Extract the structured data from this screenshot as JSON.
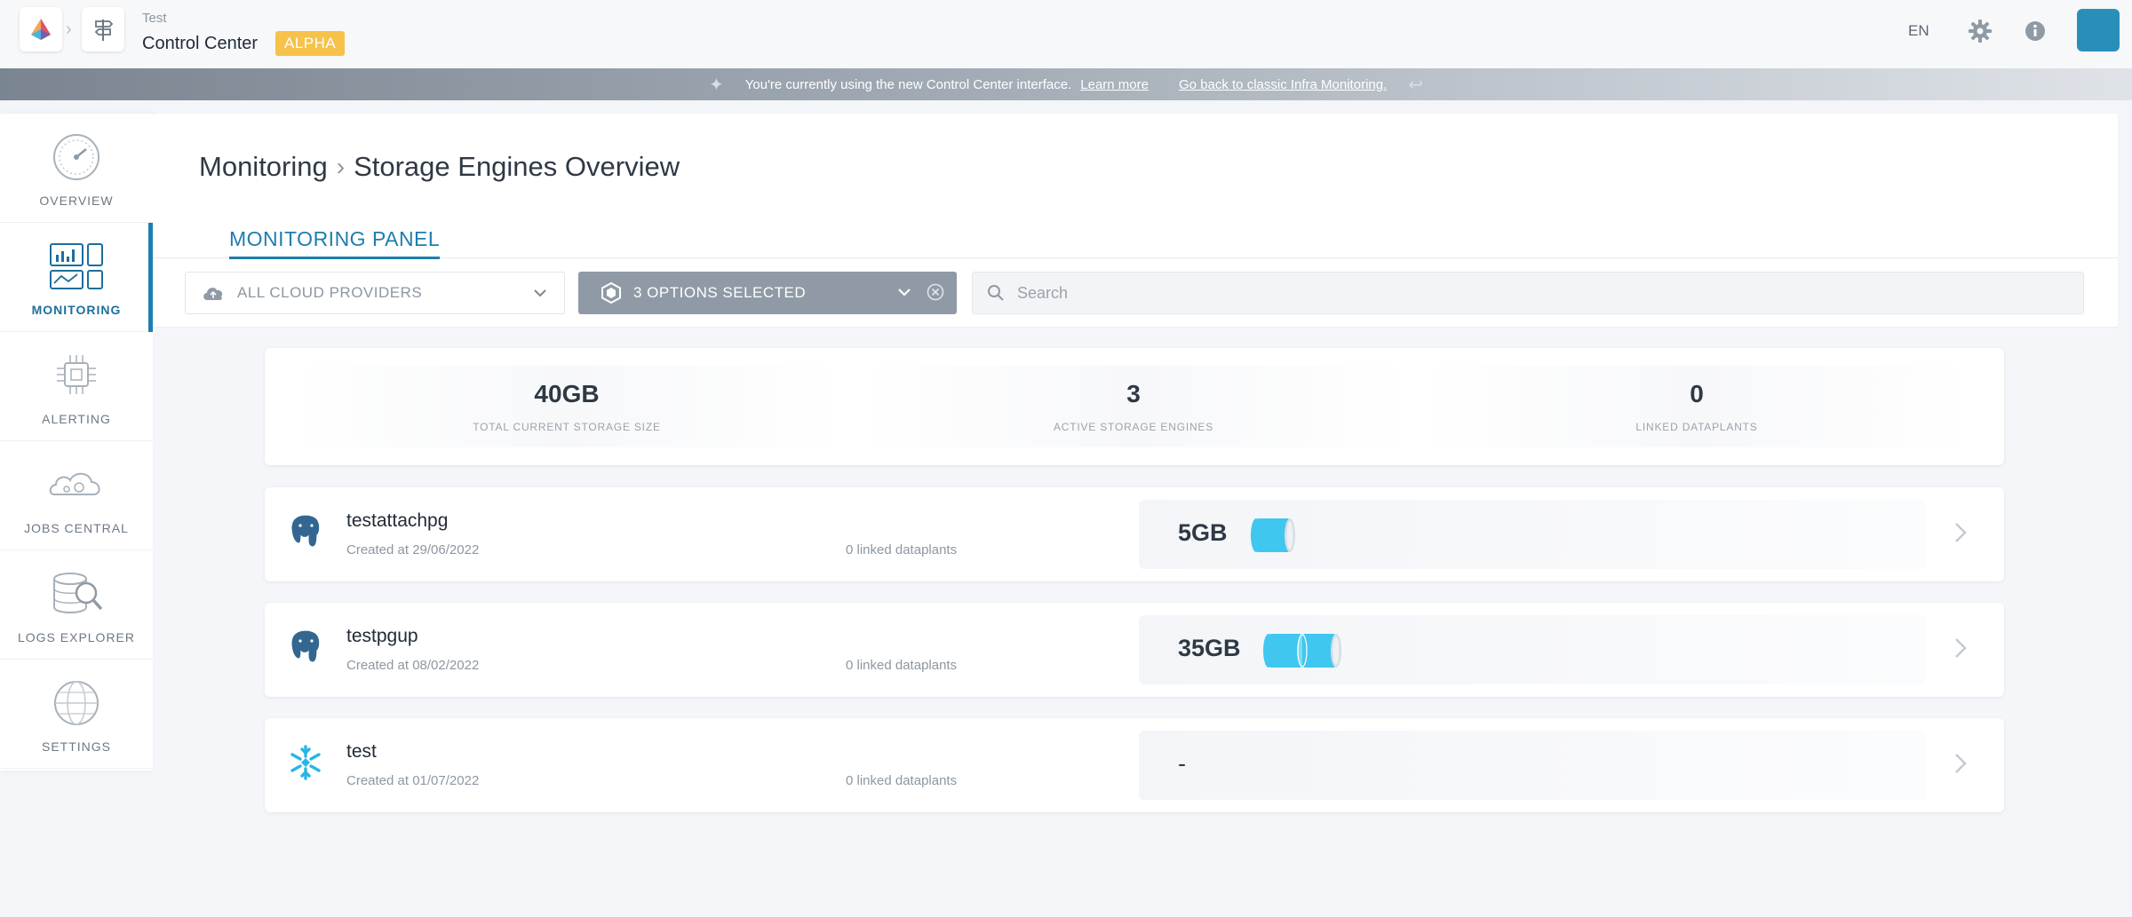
{
  "app": {
    "pre_title": "Test",
    "title": "Control Center",
    "badge": "ALPHA",
    "lang": "EN"
  },
  "banner": {
    "message": "You're currently using the new Control Center interface.",
    "learn_more": "Learn more",
    "go_back": "Go back to classic Infra Monitoring."
  },
  "sidebar": {
    "items": [
      {
        "label": "OVERVIEW",
        "icon": "gauge-icon"
      },
      {
        "label": "MONITORING",
        "icon": "monitoring-dashboard-icon",
        "active": true
      },
      {
        "label": "ALERTING",
        "icon": "alerting-chip-icon"
      },
      {
        "label": "JOBS CENTRAL",
        "icon": "jobs-cloud-icon"
      },
      {
        "label": "LOGS EXPLORER",
        "icon": "logs-database-search-icon"
      },
      {
        "label": "SETTINGS",
        "icon": "settings-globe-icon"
      }
    ]
  },
  "page": {
    "breadcrumb_root": "Monitoring",
    "breadcrumb_current": "Storage Engines Overview",
    "tab": "MONITORING PANEL"
  },
  "filters": {
    "provider": "ALL CLOUD PROVIDERS",
    "options": "3 OPTIONS SELECTED",
    "search_placeholder": "Search"
  },
  "stats": [
    {
      "value": "40GB",
      "label": "TOTAL CURRENT STORAGE SIZE"
    },
    {
      "value": "3",
      "label": "ACTIVE STORAGE ENGINES"
    },
    {
      "value": "0",
      "label": "LINKED DATAPLANTS"
    }
  ],
  "engines": [
    {
      "name": "testattachpg",
      "created": "Created at 29/06/2022",
      "linked": "0 linked dataplants",
      "size": "5GB",
      "type": "postgresql-icon",
      "cylinders": 1
    },
    {
      "name": "testpgup",
      "created": "Created at 08/02/2022",
      "linked": "0 linked dataplants",
      "size": "35GB",
      "type": "postgresql-icon",
      "cylinders": 2
    },
    {
      "name": "test",
      "created": "Created at 01/07/2022",
      "linked": "0 linked dataplants",
      "size": "-",
      "type": "snowflake-icon",
      "cylinders": 0
    }
  ],
  "colors": {
    "accent": "#1f7dae",
    "badge": "#f6c24a",
    "cylinder": "#3fc7ef"
  }
}
